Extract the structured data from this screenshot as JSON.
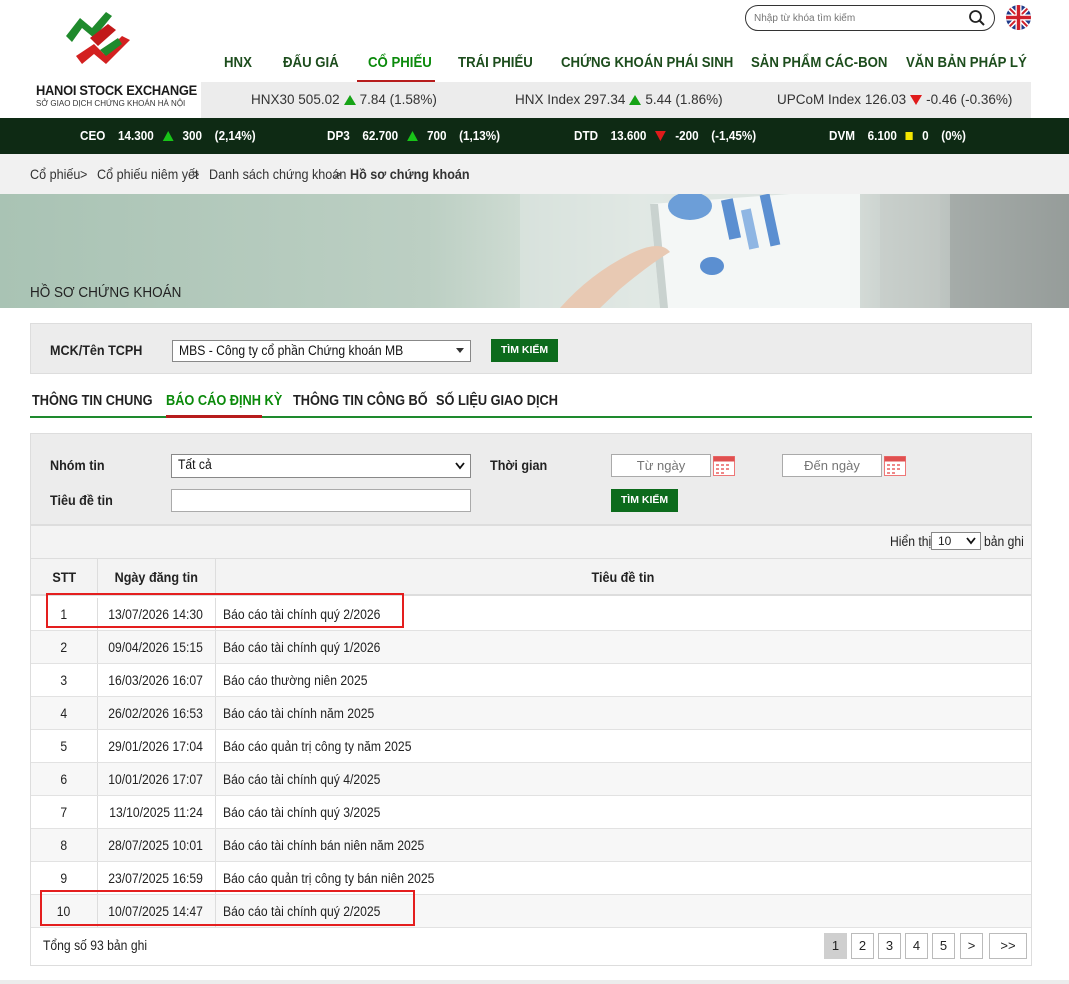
{
  "header": {
    "logo_title": "HANOI STOCK EXCHANGE",
    "logo_sub": "SỞ GIAO DỊCH CHỨNG KHOÁN HÀ NỘI",
    "search_placeholder": "Nhập từ khóa tìm kiếm",
    "nav": [
      "HNX",
      "ĐẤU GIÁ",
      "CỔ PHIẾU",
      "TRÁI PHIẾU",
      "CHỨNG KHOÁN PHÁI SINH",
      "SẢN PHẨM CÁC-BON",
      "VĂN BẢN PHÁP LÝ"
    ],
    "active_nav": "CỔ PHIẾU"
  },
  "indices": [
    {
      "name": "HNX30",
      "value": "505.02",
      "change": "7.84",
      "pct": "(1.58%)",
      "dir": "up"
    },
    {
      "name": "HNX Index",
      "value": "297.34",
      "change": "5.44",
      "pct": "(1.86%)",
      "dir": "up"
    },
    {
      "name": "UPCoM Index",
      "value": "126.03",
      "change": "-0.46",
      "pct": "(-0.36%)",
      "dir": "down"
    }
  ],
  "ticker": [
    {
      "code": "CEO",
      "price": "14.300",
      "change": "300",
      "pct": "(2,14%)",
      "dir": "up"
    },
    {
      "code": "DP3",
      "price": "62.700",
      "change": "700",
      "pct": "(1,13%)",
      "dir": "up"
    },
    {
      "code": "DTD",
      "price": "13.600",
      "change": "-200",
      "pct": "(-1,45%)",
      "dir": "down"
    },
    {
      "code": "DVM",
      "price": "6.100",
      "change": "0",
      "pct": "(0%)",
      "dir": "flat"
    }
  ],
  "breadcrumb": [
    "Cổ phiếu",
    ">",
    "Cổ phiếu niêm yết",
    ">",
    "Danh sách chứng khoán",
    ">",
    "Hồ sơ chứng khoán"
  ],
  "banner_title": "HỒ SƠ CHỨNG KHOÁN",
  "stock_search": {
    "label": "MCK/Tên TCPH",
    "value": "MBS - Công ty cổ phần Chứng khoán MB",
    "button": "TÌM KIẾM"
  },
  "tabs": [
    "THÔNG TIN CHUNG",
    "BÁO CÁO ĐỊNH KỲ",
    "THÔNG TIN CÔNG BỐ",
    "SỐ LIỆU GIAO DỊCH"
  ],
  "active_tab": "BÁO CÁO ĐỊNH KỲ",
  "filter": {
    "group_label": "Nhóm tin",
    "group_value": "Tất cả",
    "time_label": "Thời gian",
    "from_placeholder": "Từ ngày",
    "to_placeholder": "Đến ngày",
    "title_label": "Tiêu đề tin",
    "button": "TÌM KIẾM"
  },
  "table": {
    "show_label": "Hiển thị",
    "per_page": "10",
    "records_label": "bản ghi",
    "headers": [
      "STT",
      "Ngày đăng tin",
      "Tiêu đề tin"
    ],
    "rows": [
      {
        "stt": "1",
        "date": "13/07/2026 14:30",
        "title": "Báo cáo tài chính quý 2/2026"
      },
      {
        "stt": "2",
        "date": "09/04/2026 15:15",
        "title": "Báo cáo tài chính quý 1/2026"
      },
      {
        "stt": "3",
        "date": "16/03/2026 16:07",
        "title": "Báo cáo thường niên 2025"
      },
      {
        "stt": "4",
        "date": "26/02/2026 16:53",
        "title": "Báo cáo tài chính năm 2025"
      },
      {
        "stt": "5",
        "date": "29/01/2026 17:04",
        "title": "Báo cáo quản trị công ty năm 2025"
      },
      {
        "stt": "6",
        "date": "10/01/2026 17:07",
        "title": "Báo cáo tài chính quý 4/2025"
      },
      {
        "stt": "7",
        "date": "13/10/2025 11:24",
        "title": "Báo cáo tài chính quý 3/2025"
      },
      {
        "stt": "8",
        "date": "28/07/2025 10:01",
        "title": "Báo cáo tài chính bán niên năm 2025"
      },
      {
        "stt": "9",
        "date": "23/07/2025 16:59",
        "title": "Báo cáo quản trị công ty bán niên 2025"
      },
      {
        "stt": "10",
        "date": "10/07/2025 14:47",
        "title": "Báo cáo tài chính quý 2/2025"
      }
    ],
    "total": "Tổng số 93 bản ghi",
    "pages": [
      "1",
      "2",
      "3",
      "4",
      "5",
      ">",
      ">>"
    ],
    "current_page": "1"
  },
  "colors": {
    "brand_green": "#0b8a0b",
    "accent_red": "#b71c1c",
    "highlight_red": "#e41e1e",
    "ticker_bg": "#0e2a14"
  }
}
